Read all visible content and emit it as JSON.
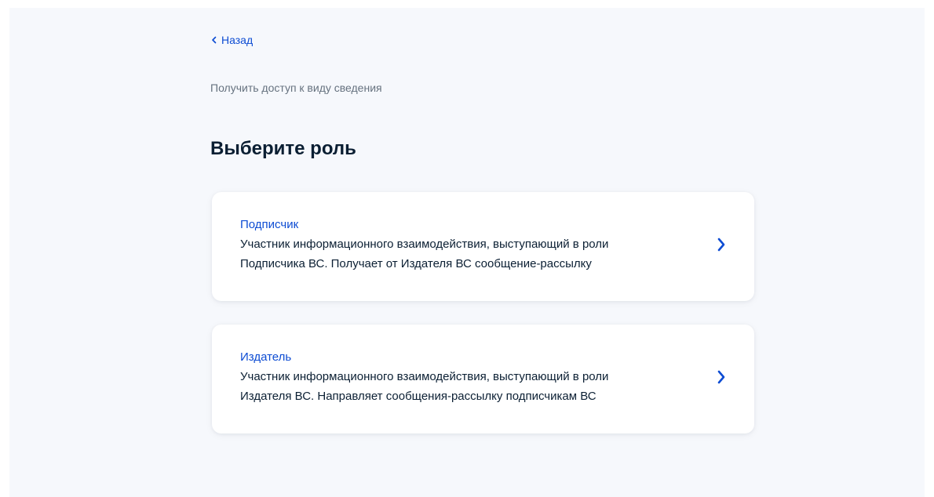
{
  "nav": {
    "back_label": "Назад"
  },
  "header": {
    "subtitle": "Получить доступ к виду сведения",
    "title": "Выберите роль"
  },
  "roles": [
    {
      "title": "Подписчик",
      "description_line1": "Участник информационного взаимодействия, выступающий в роли",
      "description_line2": "Подписчика ВС. Получает  от Издателя ВС сообщение-рассылку",
      "icon": "chevron-right-icon"
    },
    {
      "title": "Издатель",
      "description_line1": "Участник информационного взаимодействия, выступающий в роли",
      "description_line2": "Издателя ВС. Направляет сообщения-рассылку подписчикам ВС",
      "icon": "chevron-right-icon"
    }
  ],
  "colors": {
    "accent": "#0d4cd3",
    "text": "#0b1f33",
    "muted": "#66727f",
    "background": "#f6f8fc",
    "card": "#ffffff"
  }
}
